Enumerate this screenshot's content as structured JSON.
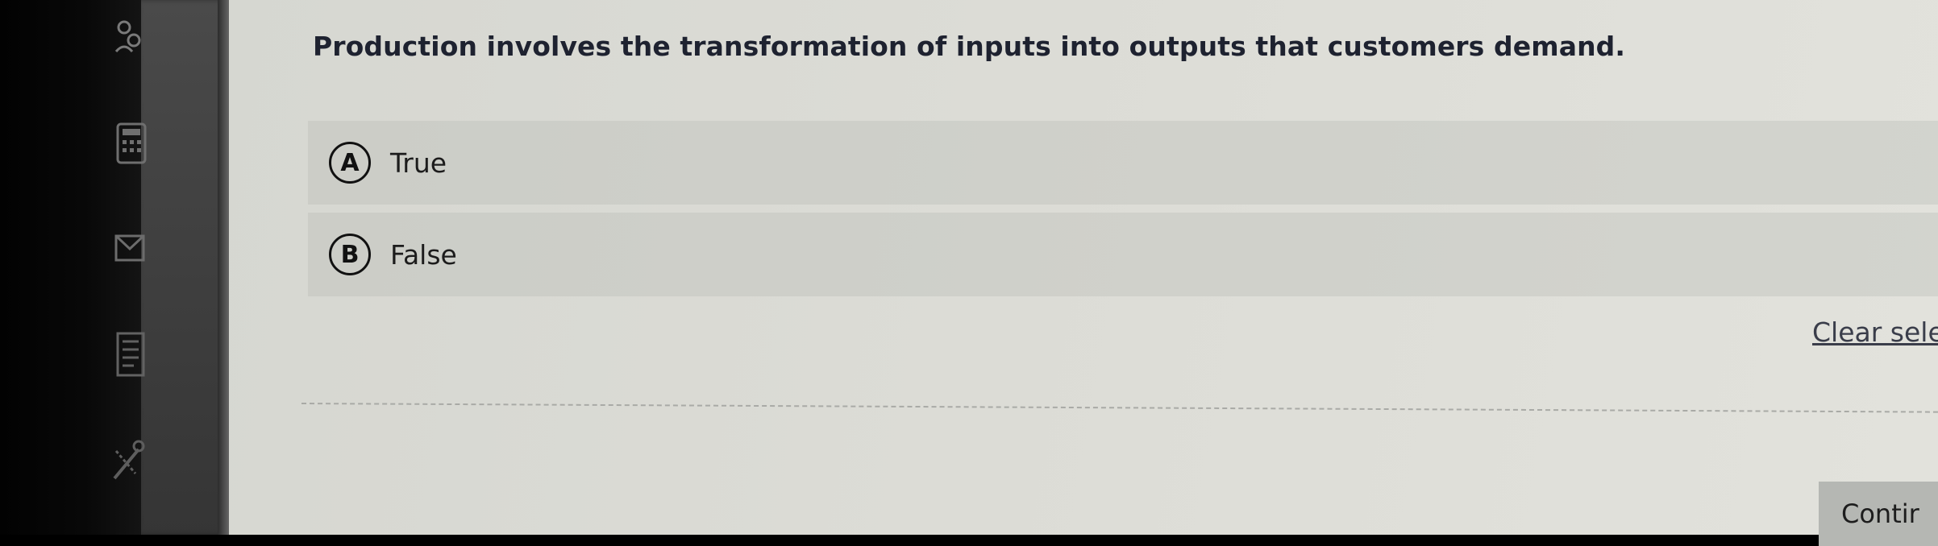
{
  "question": {
    "text": "Production involves the transformation of inputs into outputs that customers demand."
  },
  "options": [
    {
      "letter": "A",
      "label": "True"
    },
    {
      "letter": "B",
      "label": "False"
    }
  ],
  "clear_selection": {
    "label": "Clear sele"
  },
  "continue_button": {
    "label": "Contir"
  },
  "sidebar": {
    "icons": [
      "people-icon",
      "calculator-icon",
      "mail-icon",
      "notes-icon",
      "tools-icon"
    ]
  },
  "colors": {
    "question_text": "#1e2230",
    "content_bg": "#dcdcd6",
    "option_bg": "#c9cac4",
    "sidebar_bg": "#3f3f3f"
  }
}
